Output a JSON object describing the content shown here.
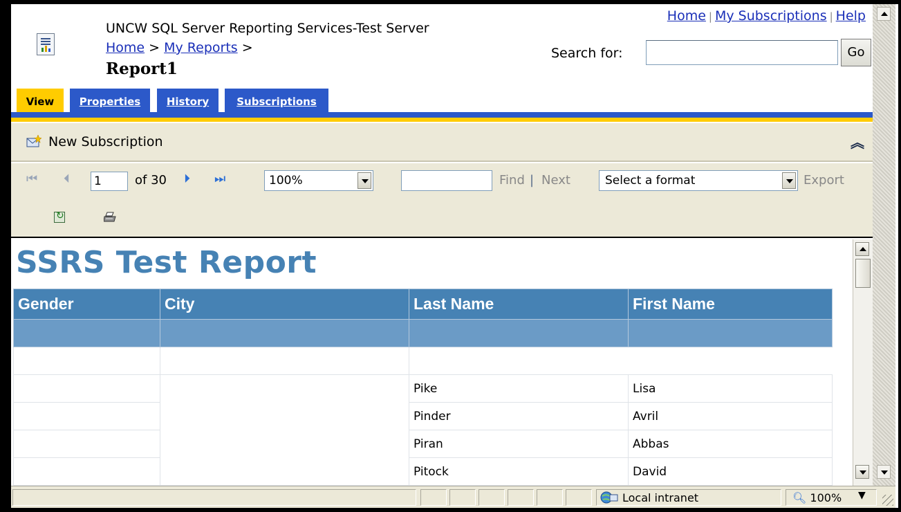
{
  "header": {
    "site_title": "UNCW SQL Server Reporting Services-Test Server",
    "breadcrumb": {
      "home": "Home",
      "sep1": " > ",
      "my_reports": "My Reports",
      "sep2": " >"
    },
    "page_title": "Report1",
    "toplinks": {
      "home": "Home",
      "sep": "|",
      "my_subscriptions": "My Subscriptions",
      "help": "Help"
    },
    "search": {
      "label": "Search for:",
      "value": "",
      "go": "Go"
    }
  },
  "tabs": [
    {
      "label": "View",
      "active": true
    },
    {
      "label": "Properties",
      "active": false
    },
    {
      "label": "History",
      "active": false
    },
    {
      "label": "Subscriptions",
      "active": false
    }
  ],
  "action_bar": {
    "new_subscription": "New Subscription"
  },
  "toolbar": {
    "page_current": "1",
    "page_of": "of 30",
    "zoom": "100%",
    "find_value": "",
    "find": "Find",
    "find_sep": "|",
    "next": "Next",
    "format": "Select a format",
    "export": "Export"
  },
  "report": {
    "title": "SSRS Test Report",
    "columns": [
      "Gender",
      "City",
      "Last Name",
      "First Name"
    ],
    "rows": [
      [
        "",
        "",
        "Pike",
        "Lisa"
      ],
      [
        "",
        "",
        "Pinder",
        "Avril"
      ],
      [
        "",
        "",
        "Piran",
        "Abbas"
      ],
      [
        "",
        "",
        "Pitock",
        "David"
      ]
    ]
  },
  "statusbar": {
    "zone": "Local intranet",
    "zoom": "100%"
  },
  "colors": {
    "tab_active": "#ffcc00",
    "tab_inactive": "#2c59c9",
    "report_header": "#4682b4",
    "group_row": "#6b9bc6",
    "toolbar_bg": "#ece9d8"
  }
}
